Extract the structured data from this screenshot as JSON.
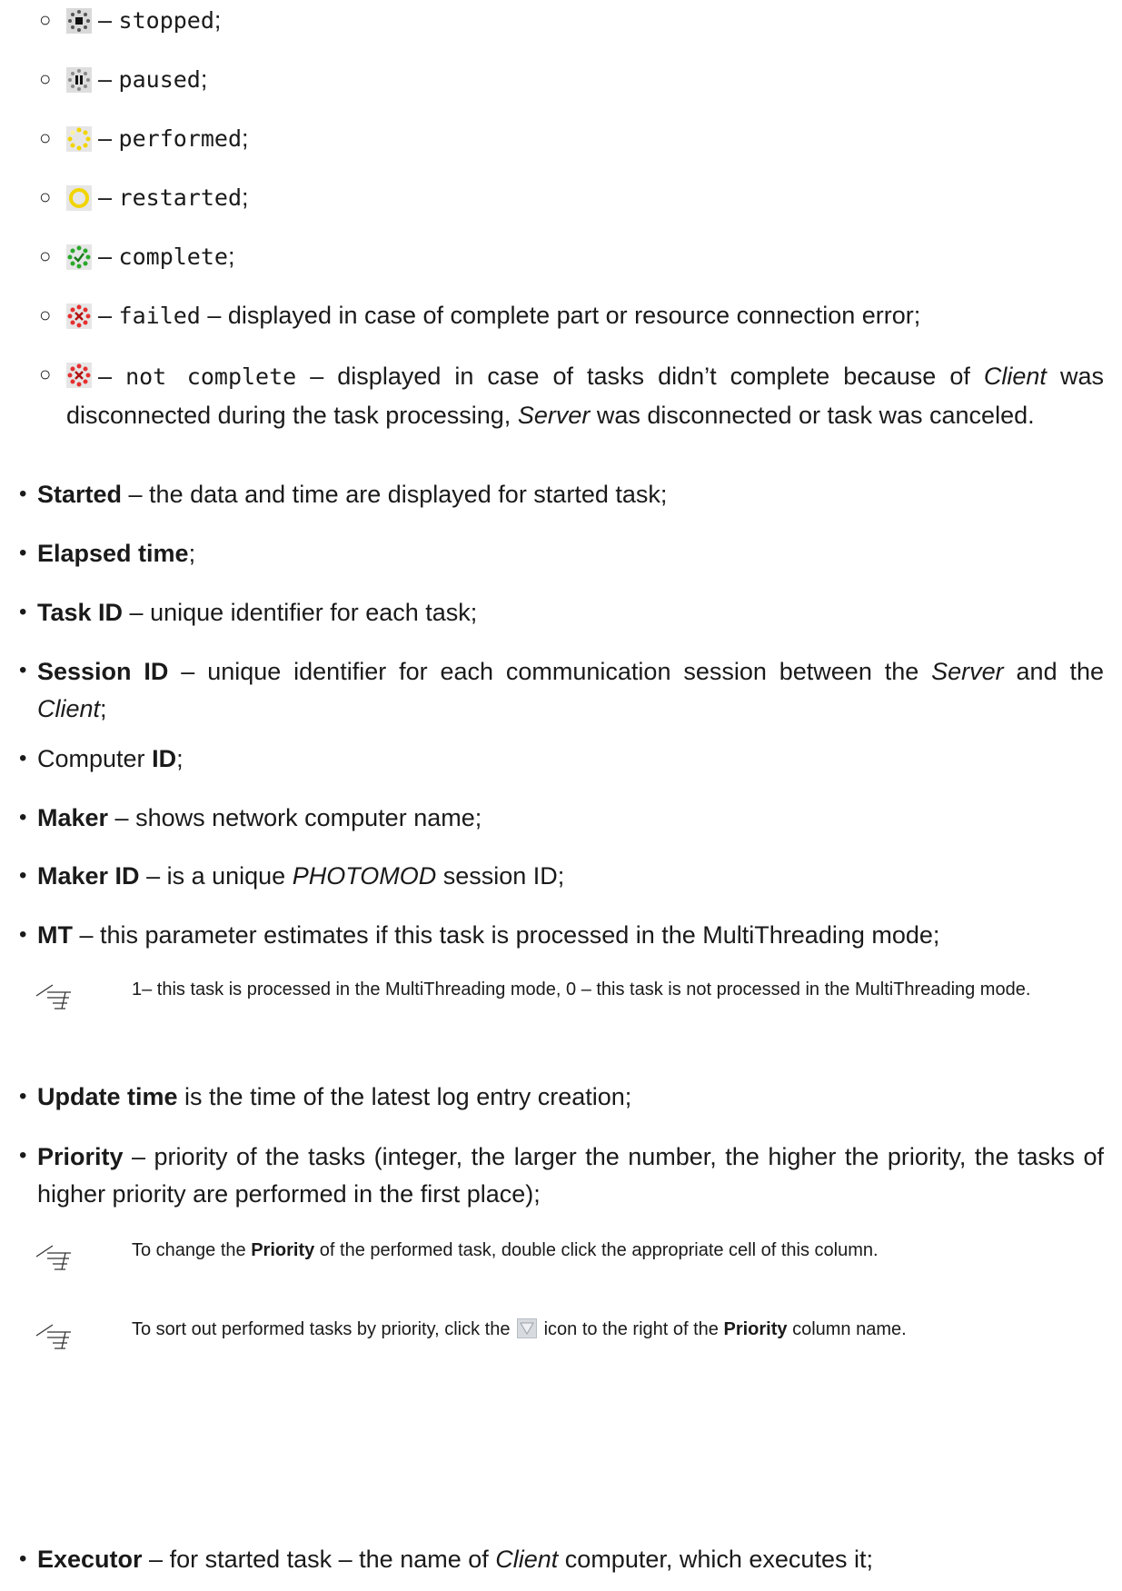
{
  "status_items": [
    {
      "icon": "stopped-status-icon",
      "label": "stopped",
      "tail": ";"
    },
    {
      "icon": "paused-status-icon",
      "label": "paused",
      "tail": ";"
    },
    {
      "icon": "performed-status-icon",
      "label": "performed",
      "tail": ";"
    },
    {
      "icon": "restarted-status-icon",
      "label": "restarted",
      "tail": ";"
    },
    {
      "icon": "complete-status-icon",
      "label": "complete",
      "tail": ";"
    },
    {
      "icon": "failed-status-icon",
      "label": "failed",
      "tail": " – displayed in case of complete part or resource connection error;"
    },
    {
      "icon": "not-complete-status-icon",
      "label": "not complete",
      "tail_a": " – displayed in case of tasks didn’t complete because of ",
      "client": "Client",
      "tail_b": " was disconnected during the task processing, ",
      "server": "Server",
      "tail_c": " was disconnected or task was canceled."
    }
  ],
  "dash": "–",
  "bullets": {
    "started": {
      "term": "Started",
      "desc": " – the data and time are displayed for started task;"
    },
    "elapsed": {
      "term": "Elapsed time",
      "desc": ";"
    },
    "task_id": {
      "term": "Task ID",
      "desc": " – unique identifier for each task;"
    },
    "session_id": {
      "term": "Session ID",
      "desc_a": " – unique identifier for each communication session between the ",
      "server": "Server",
      "desc_b": " and the ",
      "client": "Client",
      "desc_c": ";"
    },
    "computer_id": {
      "pre": "Computer ",
      "term": "ID",
      "desc": ";"
    },
    "maker": {
      "term": "Maker",
      "desc": " – shows network computer name;"
    },
    "maker_id": {
      "term": "Maker ID",
      "desc_a": " – is a unique ",
      "product": "PHOTOMOD",
      "desc_b": " session ID;"
    },
    "mt": {
      "term": "MT",
      "desc": " – this parameter estimates if this task is processed in the MultiThreading mode;"
    },
    "update_time": {
      "term": "Update time",
      "desc": " is the time of the latest log entry creation;"
    },
    "priority": {
      "term": "Priority",
      "desc": " – priority of the tasks (integer, the larger the number, the higher the priority, the tasks of higher priority are performed in the first place);"
    },
    "executor": {
      "term": "Executor",
      "desc_a": " – for started task – the name of ",
      "client": "Client",
      "desc_b": " computer, which executes it;"
    }
  },
  "notes": {
    "mt_note": "1– this task is processed in the MultiThreading mode, 0 – this task is not processed in the MultiThreading mode.",
    "priority_change": {
      "pre": "To change the ",
      "term": "Priority",
      "post": " of the performed task, double click the appropriate cell of this column."
    },
    "priority_sort": {
      "pre": "To sort out performed tasks by priority, click the ",
      "mid": " icon to the right of the ",
      "term": "Priority",
      "post": " column name."
    }
  }
}
